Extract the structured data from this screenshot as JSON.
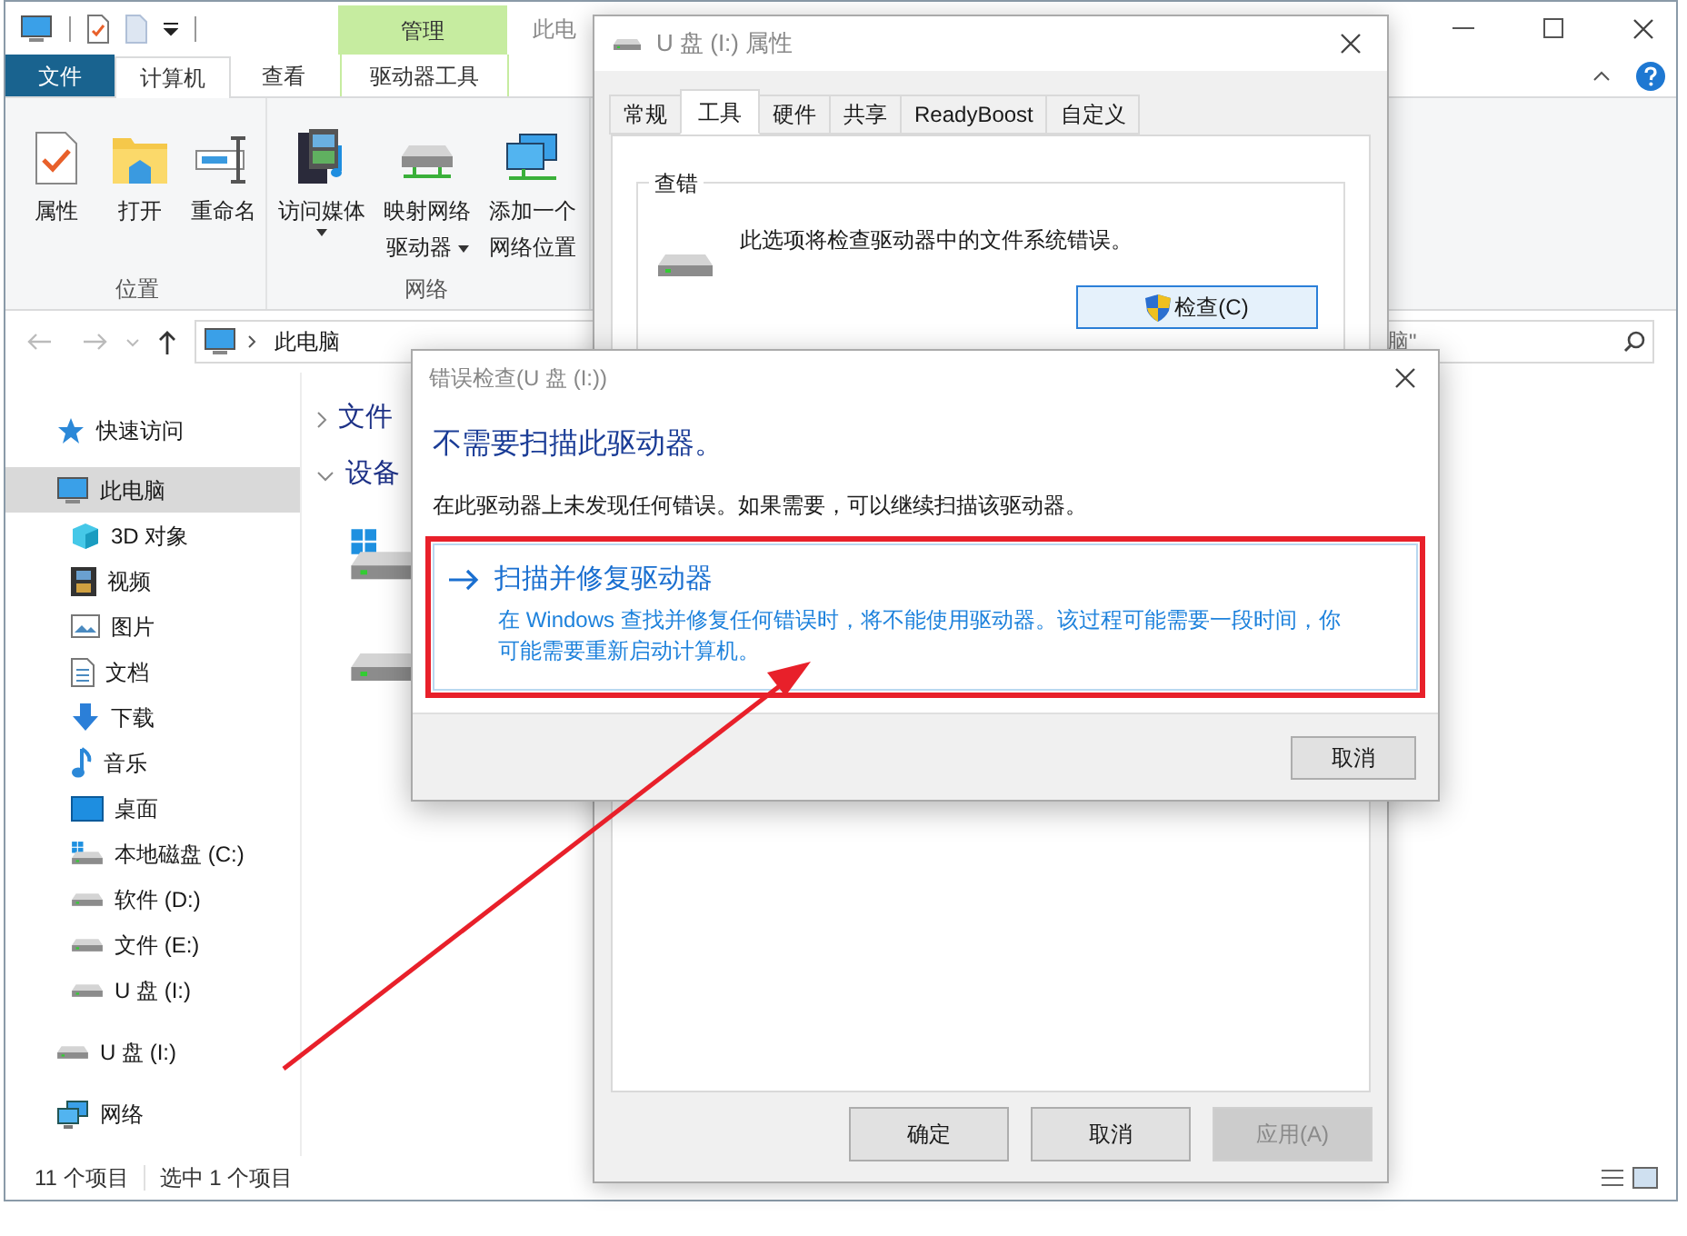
{
  "explorer": {
    "title": "此电",
    "context_tab": {
      "label": "管理"
    },
    "ribbon_tabs": [
      {
        "label": "文件",
        "kind": "file",
        "selected": false
      },
      {
        "label": "计算机",
        "kind": "tab",
        "selected": true
      },
      {
        "label": "查看",
        "kind": "tab",
        "selected": false
      },
      {
        "label": "驱动器工具",
        "kind": "context",
        "selected": false
      }
    ],
    "ribbon_groups": [
      {
        "label": "位置",
        "buttons": [
          {
            "kind": "properties",
            "lines": [
              "属性"
            ],
            "dropdown": false
          },
          {
            "kind": "open",
            "lines": [
              "打开"
            ],
            "dropdown": false
          },
          {
            "kind": "rename",
            "lines": [
              "重命名"
            ],
            "dropdown": false
          }
        ]
      },
      {
        "label": "网络",
        "buttons": [
          {
            "kind": "media",
            "lines": [
              "访问媒体"
            ],
            "dropdown": true
          },
          {
            "kind": "map",
            "lines": [
              "映射网络",
              "驱动器"
            ],
            "dropdown": true
          },
          {
            "kind": "netloc",
            "lines": [
              "添加一个",
              "网络位置"
            ],
            "dropdown": false
          }
        ]
      }
    ],
    "address": {
      "path": "此电脑"
    },
    "search": {
      "placeholder": "脑\""
    },
    "nav": [
      {
        "label": "快速访问",
        "kind": "star",
        "selected": false
      },
      {
        "label": "此电脑",
        "kind": "pc",
        "selected": true,
        "children": [
          {
            "label": "3D 对象",
            "kind": "cube",
            "selected": false
          },
          {
            "label": "视频",
            "kind": "film",
            "selected": false
          },
          {
            "label": "图片",
            "kind": "image",
            "selected": false
          },
          {
            "label": "文档",
            "kind": "doc",
            "selected": false
          },
          {
            "label": "下载",
            "kind": "download",
            "selected": false
          },
          {
            "label": "音乐",
            "kind": "music",
            "selected": false
          },
          {
            "label": "桌面",
            "kind": "desktop",
            "selected": false
          },
          {
            "label": "本地磁盘 (C:)",
            "kind": "drive_win",
            "selected": false
          },
          {
            "label": "软件 (D:)",
            "kind": "drive",
            "selected": false
          },
          {
            "label": "文件 (E:)",
            "kind": "drive",
            "selected": false
          },
          {
            "label": "U 盘 (I:)",
            "kind": "drive",
            "selected": false
          }
        ]
      },
      {
        "label": "U 盘 (I:)",
        "kind": "drive",
        "selected": false
      },
      {
        "label": "网络",
        "kind": "network",
        "selected": false
      }
    ],
    "sections": [
      {
        "label": "文件",
        "expanded": false
      },
      {
        "label": "设备",
        "expanded": true
      }
    ],
    "drives": [
      {
        "kind": "drive_win"
      },
      {
        "kind": "drive"
      }
    ],
    "status": [
      "11 个项目",
      "选中 1 个项目"
    ]
  },
  "properties_dialog": {
    "title": "U 盘 (I:) 属性",
    "tabs": [
      {
        "label": "常规",
        "selected": false
      },
      {
        "label": "工具",
        "selected": true
      },
      {
        "label": "硬件",
        "selected": false
      },
      {
        "label": "共享",
        "selected": false
      },
      {
        "label": "ReadyBoost",
        "selected": false
      },
      {
        "label": "自定义",
        "selected": false
      }
    ],
    "group_title": "查错",
    "description": "此选项将检查驱动器中的文件系统错误。",
    "check_button": "检查(C)",
    "buttons": [
      {
        "label": "确定",
        "disabled": false
      },
      {
        "label": "取消",
        "disabled": false
      },
      {
        "label": "应用(A)",
        "disabled": true
      }
    ]
  },
  "error_dialog": {
    "title": "错误检查(U 盘 (I:))",
    "heading": "不需要扫描此驱动器。",
    "message": "在此驱动器上未发现任何错误。如果需要，可以继续扫描该驱动器。",
    "option": {
      "title": "扫描并修复驱动器",
      "description": "在 Windows 查找并修复任何错误时，将不能使用驱动器。该过程可能需要一段时间，你可能需要重新启动计算机。"
    },
    "cancel_button": "取消"
  }
}
